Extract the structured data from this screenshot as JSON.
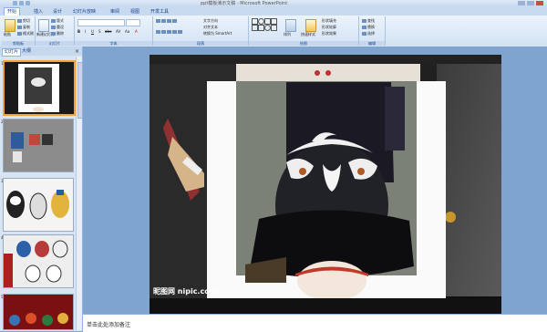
{
  "titlebar": {
    "title": "ppt模板演示文稿 - Microsoft PowerPoint"
  },
  "tabs": [
    "开始",
    "插入",
    "设计",
    "幻灯片放映",
    "审阅",
    "视图",
    "开发工具"
  ],
  "ribbon": {
    "clipboard": {
      "name": "剪贴板",
      "paste": "粘贴",
      "cut": "剪切",
      "copy": "复制",
      "format_painter": "格式刷"
    },
    "slides": {
      "name": "幻灯片",
      "new_slide": "新建幻灯片",
      "layout": "版式",
      "reset": "重设",
      "delete": "删除"
    },
    "font": {
      "name": "字体",
      "font_value": "",
      "size_value": "",
      "bold": "B",
      "italic": "I",
      "underline": "U",
      "shadow": "S",
      "strike": "abe",
      "spacing": "AV",
      "case": "Aa",
      "color": "A"
    },
    "paragraph": {
      "name": "段落",
      "text_direction": "文字方向",
      "align_text": "对齐文本",
      "convert_smartart": "转换为 SmartArt"
    },
    "drawing": {
      "name": "绘图",
      "arrange": "排列",
      "quick_styles": "快速样式",
      "shape_fill": "形状填充",
      "shape_outline": "形状轮廓",
      "shape_effects": "形状效果"
    },
    "editing": {
      "name": "编辑",
      "find": "查找",
      "replace": "替换",
      "select": "选择"
    }
  },
  "left_pane": {
    "tab_slides": "幻灯片",
    "tab_outline": "大纲",
    "thumbs": [
      "1",
      "2",
      "3",
      "4",
      "5"
    ]
  },
  "watermark": "昵图网 nipic.com",
  "notes": {
    "placeholder": "单击此处添加备注"
  },
  "colors": {
    "accent": "#15428b",
    "ribbon": "#d2e2f4",
    "workspace": "#7fa4cf"
  }
}
